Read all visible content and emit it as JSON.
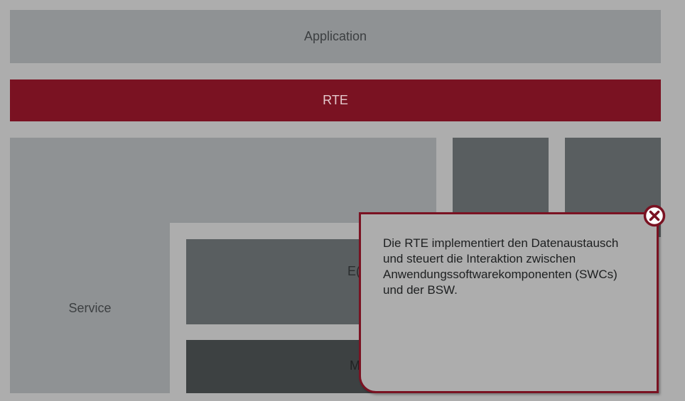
{
  "layers": {
    "application": "Application",
    "rte": "RTE",
    "service": "Service",
    "ecu_abstraction_partial": "E(",
    "mcal_partial": "M"
  },
  "tooltip": {
    "text": "Die RTE implementiert den Datenaustausch und steuert die Interaktion zwischen Anwendungssoftwarekomponenten (SWCs) und der BSW.",
    "close_icon": "close-circle-x-icon"
  },
  "colors": {
    "background": "#adadad",
    "layer_light": "#8f9294",
    "layer_dark": "#595e60",
    "layer_darkest": "#3d4142",
    "accent_red": "#7a1222"
  }
}
